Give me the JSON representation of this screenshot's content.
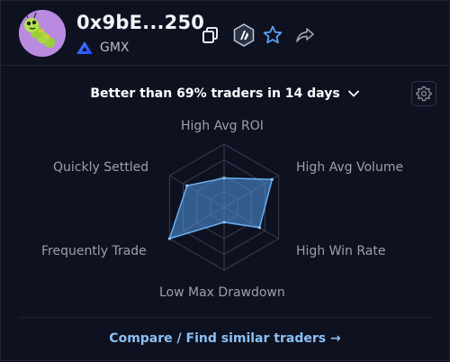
{
  "trader": {
    "address": "0x9bE...250",
    "platform": "GMX"
  },
  "icons": {
    "copy": "copy-icon",
    "network": "arbitrum-icon",
    "favorite": "star-icon",
    "share": "share-icon",
    "settings": "gear-icon",
    "dropdown": "chevron-down-icon"
  },
  "rank": {
    "label": "Better than 69% traders in 14 days"
  },
  "colors": {
    "accent": "#4d8fd6",
    "link": "#8cc0f3",
    "star": "#5aa2ef"
  },
  "chart_data": {
    "type": "radar",
    "axes": [
      "High Avg ROI",
      "High Avg Volume",
      "High Win Rate",
      "Low Max Drawdown",
      "Frequently Trade",
      "Quickly Settled"
    ],
    "values": [
      0.46,
      0.88,
      0.65,
      0.24,
      1.0,
      0.68
    ],
    "max": 1.0,
    "rings": 4
  },
  "footer": {
    "compare_label": "Compare / Find similar traders →"
  }
}
